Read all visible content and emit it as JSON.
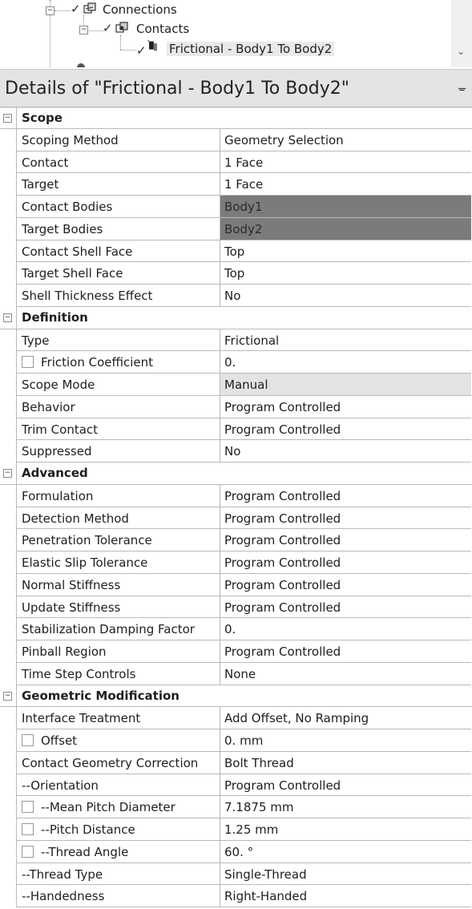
{
  "tree": {
    "nodes": [
      {
        "label": "Connections",
        "icon": "connections-icon",
        "expander": "−"
      },
      {
        "label": "Contacts",
        "icon": "contacts-icon",
        "expander": "−"
      },
      {
        "label": "Frictional - Body1 To Body2",
        "icon": "frictional-contact-icon",
        "selected": true
      }
    ],
    "check_glyph": "✓",
    "scroll_down_glyph": "⌄"
  },
  "details": {
    "title": "Details of \"Frictional - Body1 To Body2\"",
    "pin_glyph": "ᚚ"
  },
  "groups": [
    {
      "name": "Scope",
      "rows": [
        {
          "name": "Scoping Method",
          "value": "Geometry Selection"
        },
        {
          "name": "Contact",
          "value": "1 Face"
        },
        {
          "name": "Target",
          "value": "1 Face"
        },
        {
          "name": "Contact Bodies",
          "value": "Body1",
          "style": "dark"
        },
        {
          "name": "Target Bodies",
          "value": "Body2",
          "style": "dark"
        },
        {
          "name": "Contact Shell Face",
          "value": "Top"
        },
        {
          "name": "Target Shell Face",
          "value": "Top"
        },
        {
          "name": "Shell Thickness Effect",
          "value": "No"
        }
      ]
    },
    {
      "name": "Definition",
      "rows": [
        {
          "name": "Type",
          "value": "Frictional"
        },
        {
          "name": "Friction Coefficient",
          "value": "0.",
          "checkbox": true
        },
        {
          "name": "Scope Mode",
          "value": "Manual",
          "style": "light"
        },
        {
          "name": "Behavior",
          "value": "Program Controlled"
        },
        {
          "name": "Trim Contact",
          "value": "Program Controlled"
        },
        {
          "name": "Suppressed",
          "value": "No"
        }
      ]
    },
    {
      "name": "Advanced",
      "rows": [
        {
          "name": "Formulation",
          "value": "Program Controlled"
        },
        {
          "name": "Detection Method",
          "value": "Program Controlled"
        },
        {
          "name": "Penetration Tolerance",
          "value": "Program Controlled"
        },
        {
          "name": "Elastic Slip Tolerance",
          "value": "Program Controlled"
        },
        {
          "name": "Normal Stiffness",
          "value": "Program Controlled"
        },
        {
          "name": "Update Stiffness",
          "value": "Program Controlled"
        },
        {
          "name": "Stabilization Damping Factor",
          "value": "0."
        },
        {
          "name": "Pinball Region",
          "value": "Program Controlled"
        },
        {
          "name": "Time Step Controls",
          "value": "None"
        }
      ]
    },
    {
      "name": "Geometric Modification",
      "rows": [
        {
          "name": "Interface Treatment",
          "value": "Add Offset, No Ramping"
        },
        {
          "name": "Offset",
          "value": "0. mm",
          "checkbox": true
        },
        {
          "name": "Contact Geometry Correction",
          "value": "Bolt Thread"
        },
        {
          "name": "--Orientation",
          "value": "Program Controlled"
        },
        {
          "name": "--Mean Pitch Diameter",
          "value": "7.1875 mm",
          "checkbox": true
        },
        {
          "name": "--Pitch Distance",
          "value": "1.25 mm",
          "checkbox": true
        },
        {
          "name": "--Thread Angle",
          "value": "60. °",
          "checkbox": true
        },
        {
          "name": "--Thread Type",
          "value": "Single-Thread"
        },
        {
          "name": "--Handedness",
          "value": "Right-Handed"
        }
      ]
    }
  ],
  "collapse_glyph": "−"
}
